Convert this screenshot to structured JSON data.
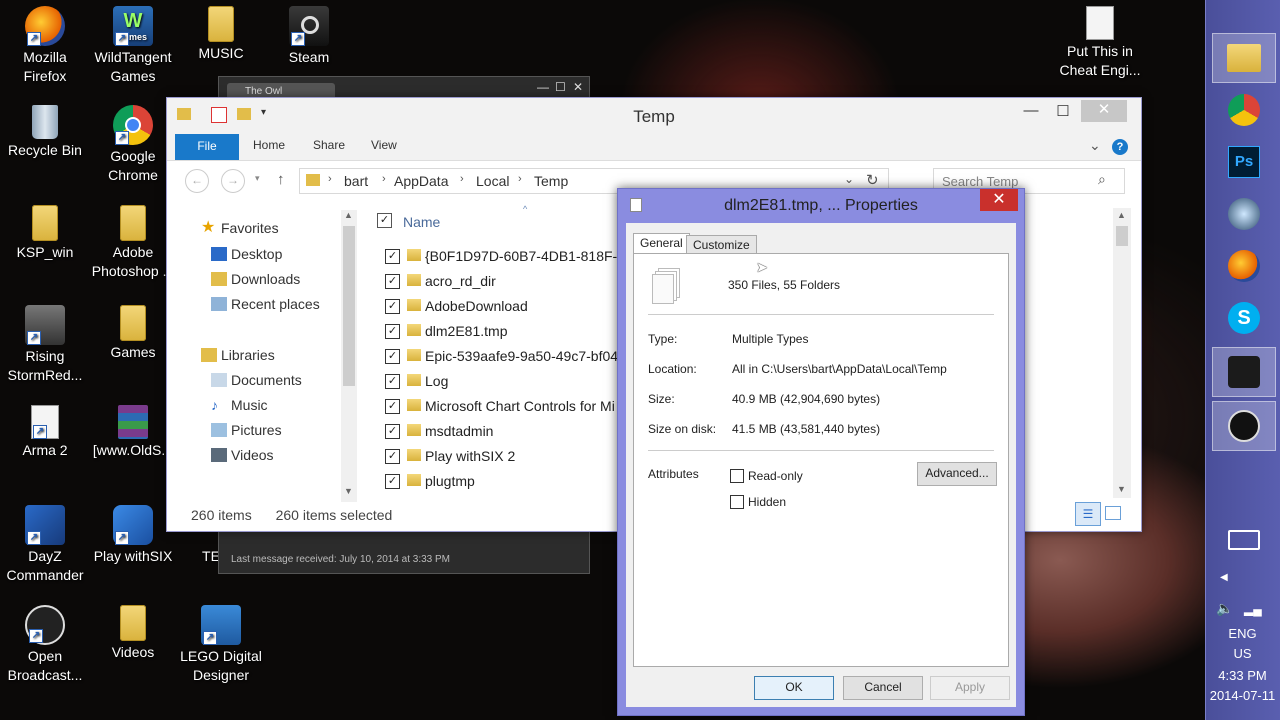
{
  "desktop": {
    "icons": [
      {
        "label": "Mozilla Firefox"
      },
      {
        "label": "WildTangent Games",
        "badge": "Games"
      },
      {
        "label": "MUSIC"
      },
      {
        "label": "Steam"
      },
      {
        "label": "Put This in Cheat Engi..."
      },
      {
        "label": "Recycle Bin"
      },
      {
        "label": "Google Chrome"
      },
      {
        "label": "KSP_win"
      },
      {
        "label": "Adobe Photoshop ..."
      },
      {
        "label": "Rising StormRed..."
      },
      {
        "label": "Games"
      },
      {
        "label": "Arma 2"
      },
      {
        "label": "[www.OldS..."
      },
      {
        "label": "DayZ Commander"
      },
      {
        "label": "Play withSIX"
      },
      {
        "label": "TE"
      },
      {
        "label": "Open Broadcast..."
      },
      {
        "label": "Videos"
      },
      {
        "label": "LEGO Digital Designer"
      }
    ]
  },
  "background_window": {
    "tab": "The Owl",
    "footer": "Last message received: July 10, 2014 at 3:33 PM"
  },
  "explorer": {
    "title": "Temp",
    "ribbon": {
      "file": "File",
      "home": "Home",
      "share": "Share",
      "view": "View"
    },
    "path": [
      "bart",
      "AppData",
      "Local",
      "Temp"
    ],
    "search_placeholder": "Search Temp",
    "nav": {
      "favorites": "Favorites",
      "desktop": "Desktop",
      "downloads": "Downloads",
      "recent": "Recent places",
      "libraries": "Libraries",
      "documents": "Documents",
      "music": "Music",
      "pictures": "Pictures",
      "videos": "Videos"
    },
    "column_name": "Name",
    "files": [
      "{B0F1D97D-60B7-4DB1-818F-2",
      "acro_rd_dir",
      "AdobeDownload",
      "dlm2E81.tmp",
      "Epic-539aafe9-9a50-49c7-bf04",
      "Log",
      "Microsoft Chart Controls for Mi",
      "msdtadmin",
      "Play withSIX 2",
      "plugtmp"
    ],
    "status_items": "260 items",
    "status_selected": "260 items selected"
  },
  "properties": {
    "title": "dlm2E81.tmp, ... Properties",
    "tabs": {
      "general": "General",
      "customize": "Customize"
    },
    "summary": "350 Files, 55 Folders",
    "type_label": "Type:",
    "type_value": "Multiple Types",
    "location_label": "Location:",
    "location_value": "All in C:\\Users\\bart\\AppData\\Local\\Temp",
    "size_label": "Size:",
    "size_value": "40.9 MB (42,904,690 bytes)",
    "size_disk_label": "Size on disk:",
    "size_disk_value": "41.5 MB (43,581,440 bytes)",
    "attributes_label": "Attributes",
    "readonly_label": "Read-only",
    "hidden_label": "Hidden",
    "advanced_button": "Advanced...",
    "ok_button": "OK",
    "cancel_button": "Cancel",
    "apply_button": "Apply"
  },
  "tray": {
    "lang1": "ENG",
    "lang2": "US",
    "time": "4:33 PM",
    "date": "2014-07-11"
  },
  "colors": {
    "taskbar": "#5257a8",
    "dialog_frame": "#8a8ce0",
    "file_tab": "#1979ca",
    "close_red": "#c9302c"
  }
}
